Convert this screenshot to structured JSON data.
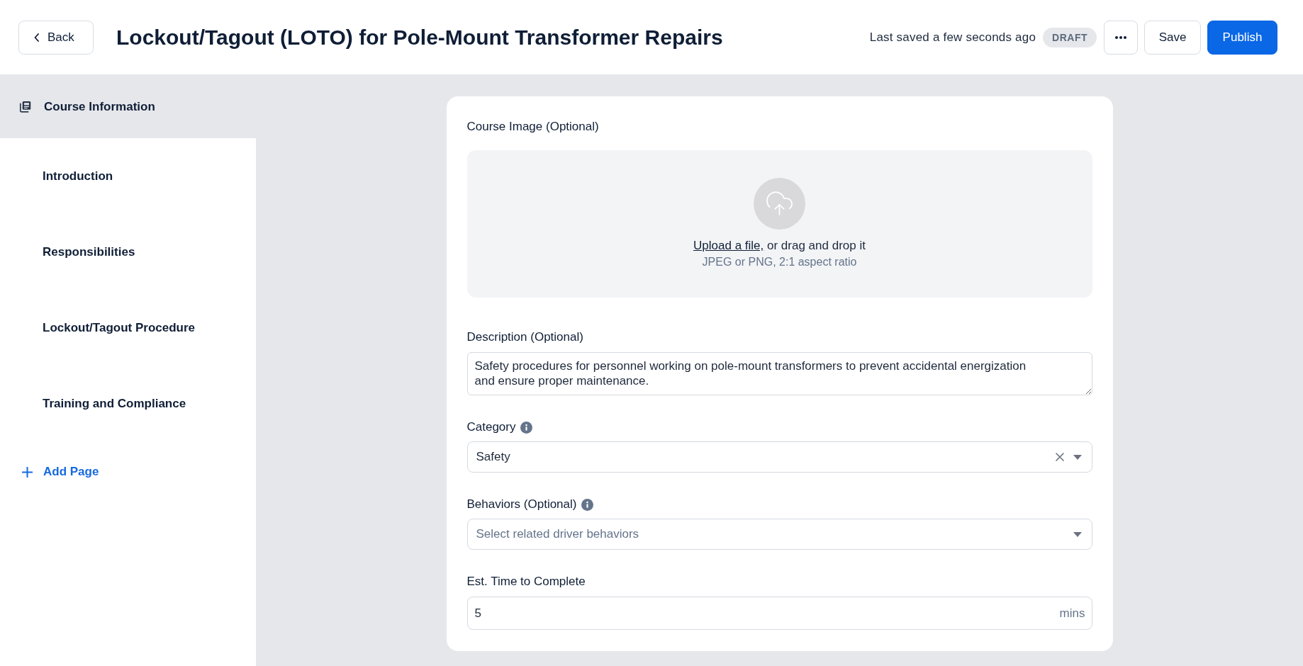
{
  "header": {
    "back_label": "Back",
    "title": "Lockout/Tagout (LOTO) for Pole-Mount Transformer Repairs",
    "save_status": "Last saved a few seconds ago",
    "status_badge": "DRAFT",
    "actions": [
      {
        "kind": "more"
      },
      {
        "kind": "secondary",
        "label": "Save"
      },
      {
        "kind": "primary",
        "label": "Publish"
      }
    ]
  },
  "sidebar": {
    "items": [
      {
        "kind": "info",
        "label": "Course Information",
        "selected": true
      },
      {
        "kind": "page",
        "label": "Introduction",
        "selected": false
      },
      {
        "kind": "page",
        "label": "Responsibilities",
        "selected": false
      },
      {
        "kind": "page",
        "label": "Lockout/Tagout Procedure",
        "selected": false
      },
      {
        "kind": "page",
        "label": "Training and Compliance",
        "selected": false
      }
    ],
    "add_page": "Add Page"
  },
  "form": {
    "fields": [
      {
        "kind": "image",
        "label": "Course Image (Optional)",
        "info": false,
        "upload_link": "Upload a file,",
        "upload_text": "or drag and drop it",
        "hint": "JPEG or PNG, 2:1 aspect ratio"
      },
      {
        "kind": "textarea",
        "label": "Description (Optional)",
        "info": false,
        "value": "Safety procedures for personnel working on pole-mount transformers to prevent accidental energization and ensure proper maintenance."
      },
      {
        "kind": "select",
        "label": "Category",
        "info": true,
        "value": "Safety"
      },
      {
        "kind": "select",
        "label": "Behaviors (Optional)",
        "info": true,
        "placeholder": "Select related driver behaviors"
      },
      {
        "kind": "number",
        "label": "Est. Time to Complete",
        "info": false,
        "value": "5",
        "unit": "mins"
      }
    ]
  }
}
